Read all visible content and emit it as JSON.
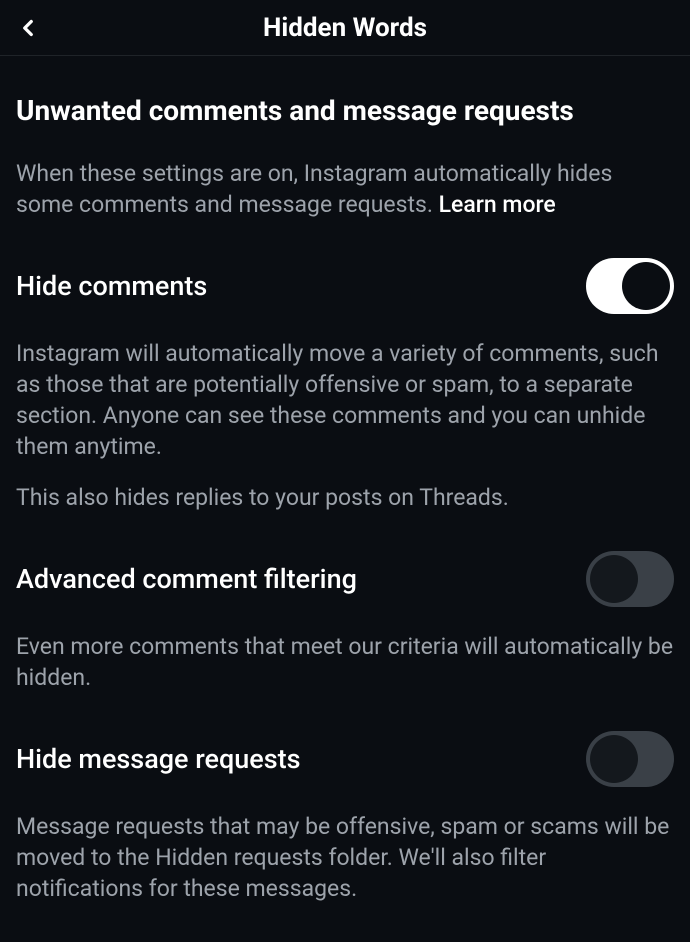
{
  "header": {
    "title": "Hidden Words"
  },
  "section": {
    "title": "Unwanted comments and message requests",
    "descriptionPrefix": "When these settings are on, Instagram automatically hides some comments and message requests. ",
    "learnMore": "Learn more"
  },
  "settings": {
    "hideComments": {
      "label": "Hide comments",
      "description": "Instagram will automatically move a variety of comments, such as those that are potentially offensive or spam, to a separate section. Anyone can see these comments and you can unhide them anytime.",
      "secondaryDescription": "This also hides replies to your posts on Threads.",
      "enabled": true
    },
    "advancedFiltering": {
      "label": "Advanced comment filtering",
      "description": "Even more comments that meet our criteria will automatically be hidden.",
      "enabled": false
    },
    "hideMessageRequests": {
      "label": "Hide message requests",
      "description": "Message requests that may be offensive, spam or scams will be moved to the Hidden requests folder. We'll also filter notifications for these messages.",
      "enabled": false
    }
  }
}
